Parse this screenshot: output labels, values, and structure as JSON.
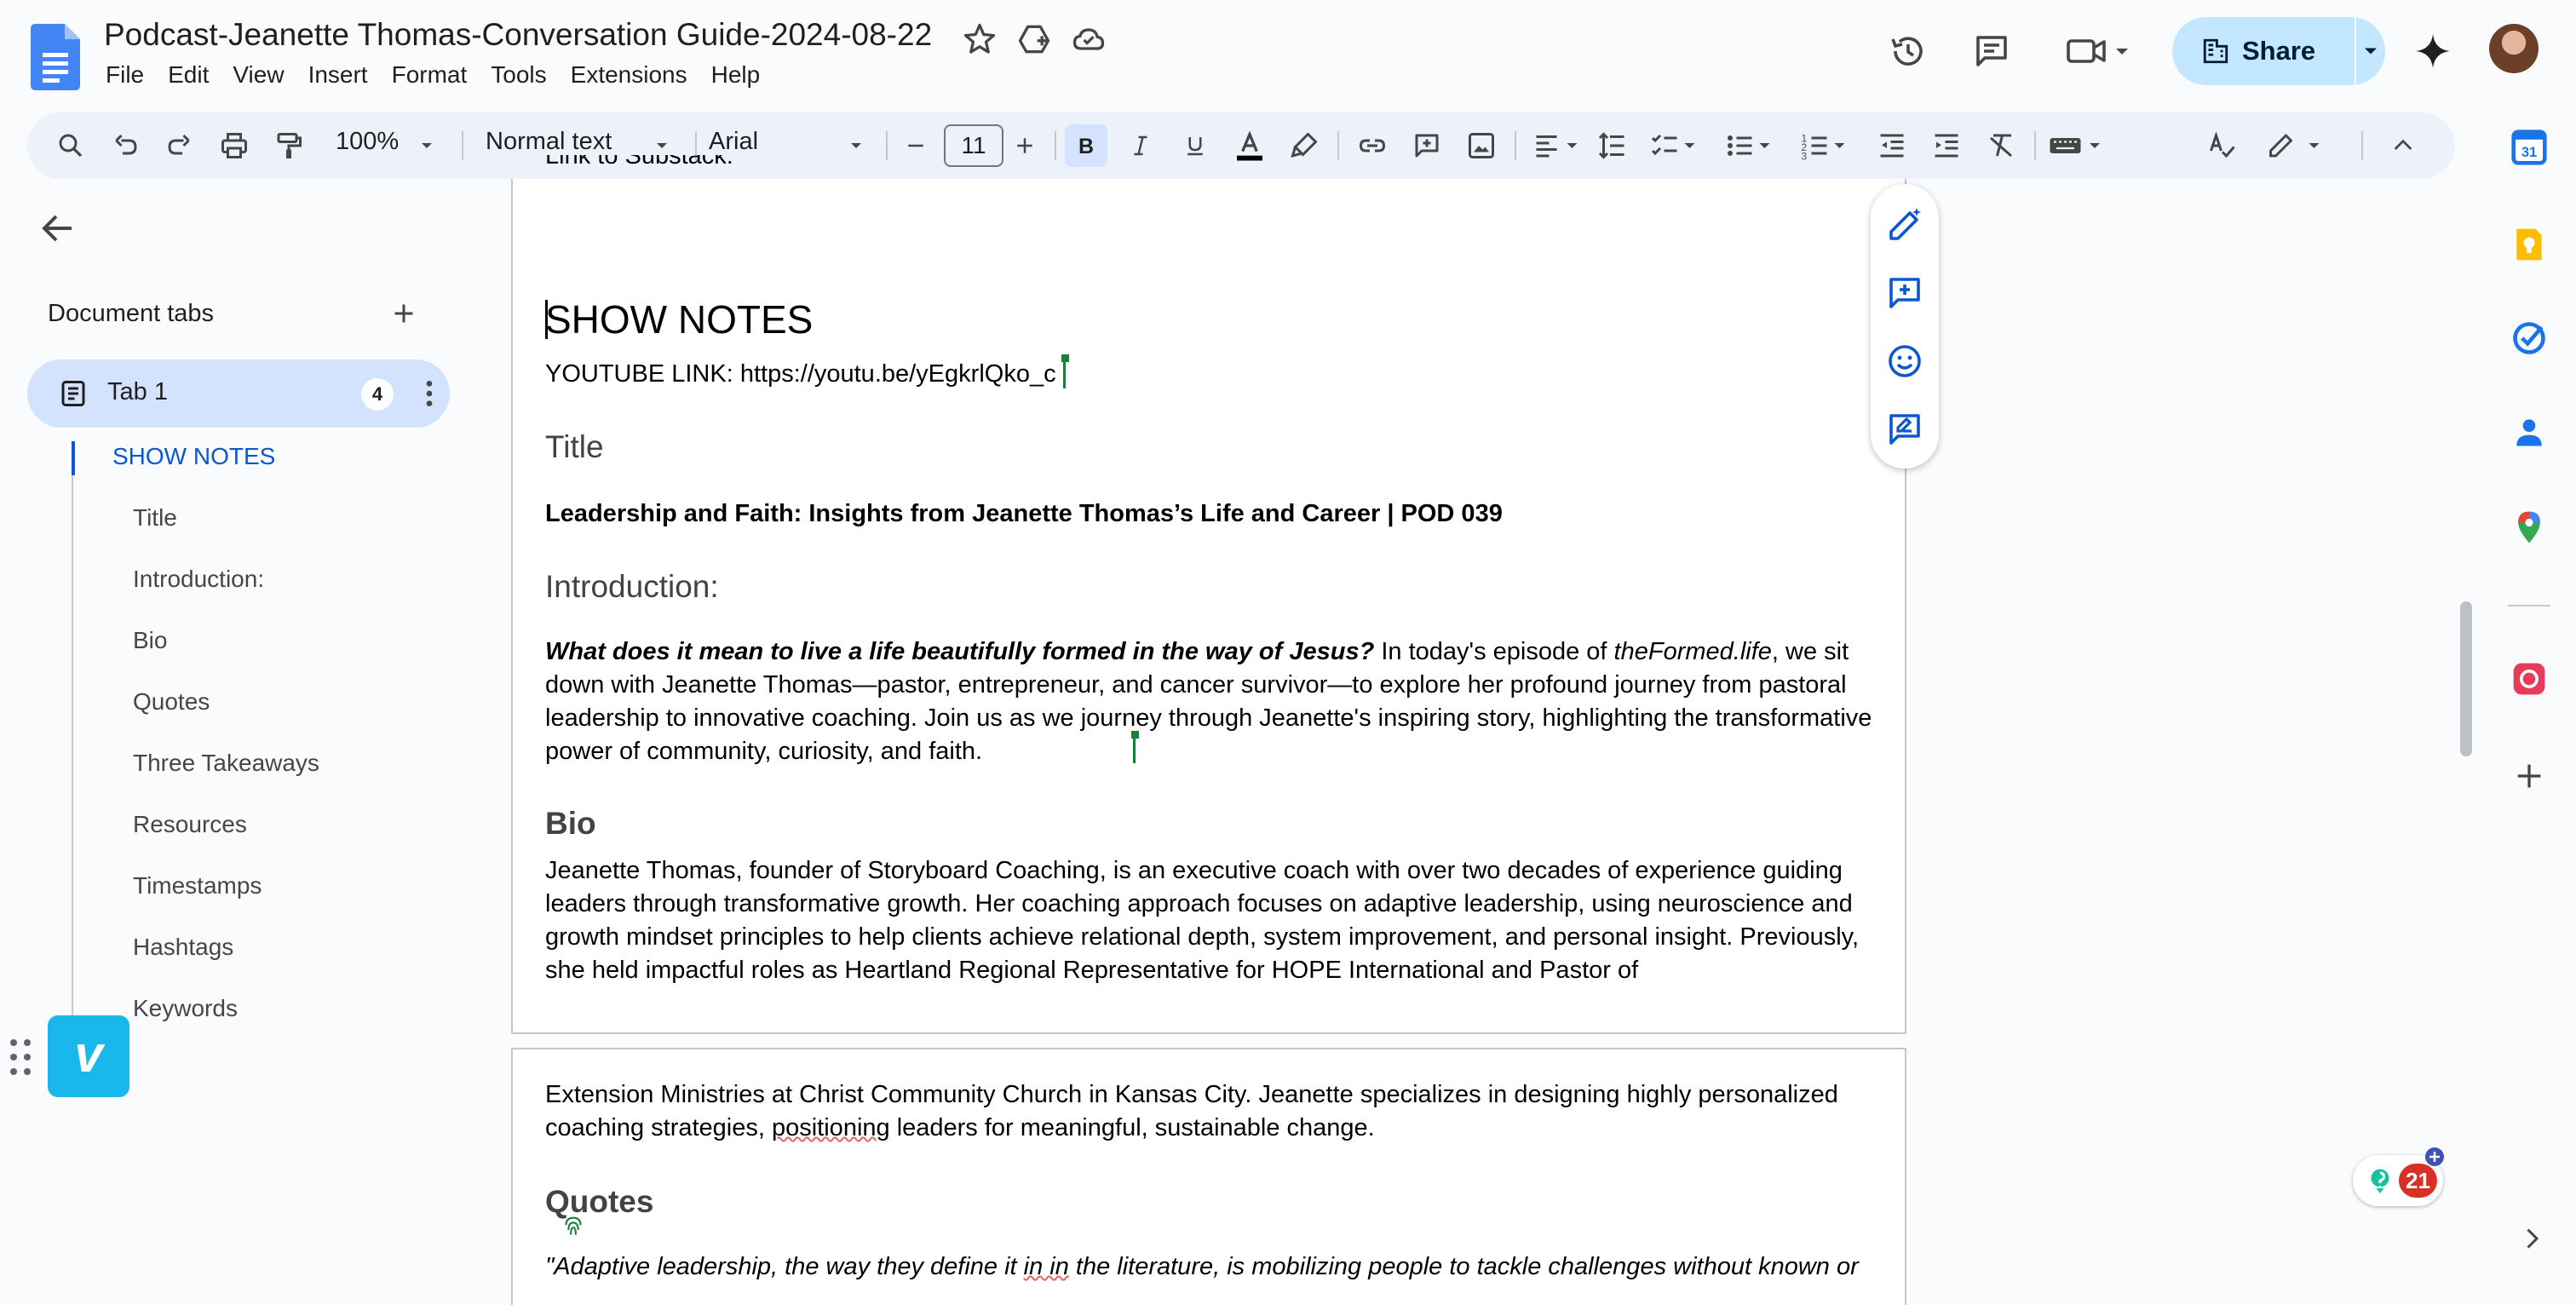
{
  "app": {
    "doc_title": "Podcast-Jeanette Thomas-Conversation Guide-2024-08-22",
    "menu": [
      "File",
      "Edit",
      "View",
      "Insert",
      "Format",
      "Tools",
      "Extensions",
      "Help"
    ],
    "share_label": "Share"
  },
  "toolbar": {
    "zoom": "100%",
    "style": "Normal text",
    "font": "Arial",
    "font_size": "11"
  },
  "sidebar": {
    "heading": "Document tabs",
    "tab_label": "Tab 1",
    "tab_count": "4",
    "outline": [
      "SHOW NOTES",
      "Title",
      "Introduction:",
      "Bio",
      "Quotes",
      "Three Takeaways",
      "Resources",
      "Timestamps",
      "Hashtags",
      "Keywords"
    ]
  },
  "doc": {
    "cut_line": "Link to Substack:",
    "show_notes": "SHOW NOTES",
    "youtube": "YOUTUBE LINK: https://youtu.be/yEgkrlQko_c",
    "title_heading": "Title",
    "title_text": "Leadership and Faith: Insights from Jeanette Thomas’s Life and Career | POD 039",
    "intro_heading": "Introduction:",
    "intro_bold": "What does it mean to live a life beautifully formed in the way of Jesus?",
    "intro_p1": " In today's episode of ",
    "intro_italic": "theFormed.life",
    "intro_p2": ", we sit down with Jeanette Thomas—pastor, entrepreneur, and cancer survivor—to explore her profound journey from pastoral leadership to innovative coaching. Join us as we journey through Jeanette's inspiring story, highlighting the transformative power of community, curiosity, and faith.",
    "bio_heading": "Bio",
    "bio_p1": "Jeanette Thomas, founder of Storyboard Coaching, is an executive coach with over two decades of experience guiding leaders through transformative growth. Her coaching approach focuses on adaptive leadership, using neuroscience and growth mindset principles to help clients achieve relational depth, system improvement, and personal insight. Previously, she held impactful roles as Heartland Regional Representative for HOPE International and Pastor of",
    "bio_p2a": "Extension Ministries at Christ Community Church in Kansas City. Jeanette specializes in designing highly personalized coaching strategies, ",
    "bio_p2_squiggle": "positioning",
    "bio_p2b": " leaders for meaningful, sustainable change.",
    "quotes_heading": "Quotes",
    "quote_a": "\"Adaptive leadership, the way they define it ",
    "quote_squiggle": "in in",
    "quote_b": " the literature, is mobilizing people to tackle challenges without known or"
  },
  "badges": {
    "grammarly_count": "21",
    "vimeo_glyph": "v"
  },
  "colors": {
    "accent": "#0b57d0",
    "share_bg": "#c2e7ff",
    "tab_active_bg": "#d3e3fd",
    "toolbar_bg": "#edf2fa"
  }
}
